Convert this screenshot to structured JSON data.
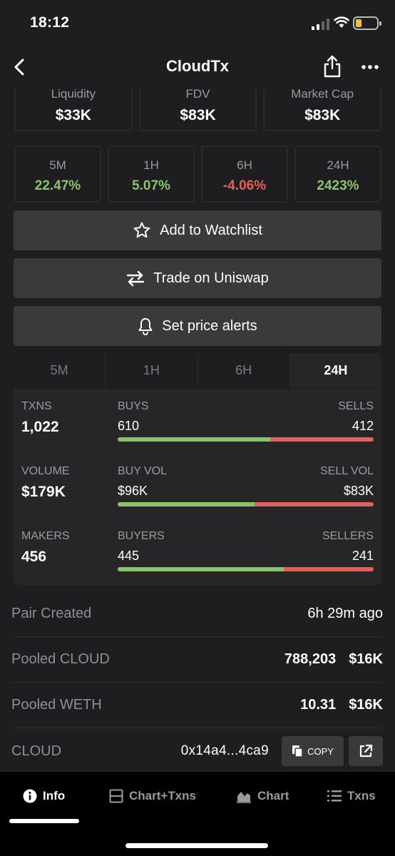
{
  "status": {
    "time": "18:12"
  },
  "nav": {
    "title": "CloudTx"
  },
  "top_stats": [
    {
      "label": "Liquidity",
      "value": "$33K"
    },
    {
      "label": "FDV",
      "value": "$83K"
    },
    {
      "label": "Market Cap",
      "value": "$83K"
    }
  ],
  "price_changes": [
    {
      "label": "5M",
      "value": "22.47%",
      "trend": "up"
    },
    {
      "label": "1H",
      "value": "5.07%",
      "trend": "up"
    },
    {
      "label": "6H",
      "value": "-4.06%",
      "trend": "down"
    },
    {
      "label": "24H",
      "value": "2423%",
      "trend": "up"
    }
  ],
  "actions": {
    "watchlist": "Add to Watchlist",
    "trade": "Trade on Uniswap",
    "alerts": "Set price alerts"
  },
  "period_tabs": [
    {
      "label": "5M",
      "active": false
    },
    {
      "label": "1H",
      "active": false
    },
    {
      "label": "6H",
      "active": false
    },
    {
      "label": "24H",
      "active": true
    }
  ],
  "metrics": {
    "txns": {
      "label": "TXNS",
      "value": "1,022",
      "left_label": "BUYS",
      "left_value": "610",
      "right_label": "SELLS",
      "right_value": "412",
      "left_share": 0.597
    },
    "volume": {
      "label": "VOLUME",
      "value": "$179K",
      "left_label": "BUY VOL",
      "left_value": "$96K",
      "right_label": "SELL VOL",
      "right_value": "$83K",
      "left_share": 0.536
    },
    "makers": {
      "label": "MAKERS",
      "value": "456",
      "left_label": "BUYERS",
      "left_value": "445",
      "right_label": "SELLERS",
      "right_value": "241",
      "left_share": 0.649
    }
  },
  "info": {
    "pair_created": {
      "label": "Pair Created",
      "value": "6h 29m ago"
    },
    "pooled_cloud": {
      "label": "Pooled CLOUD",
      "amount": "788,203",
      "usd": "$16K"
    },
    "pooled_weth": {
      "label": "Pooled WETH",
      "amount": "10.31",
      "usd": "$16K"
    },
    "token": {
      "label": "CLOUD",
      "address": "0x14a4...4ca9",
      "copy_label": "COPY"
    }
  },
  "tabbar": [
    {
      "label": "Info",
      "icon": "info-icon",
      "active": true
    },
    {
      "label": "Chart+Txns",
      "icon": "split-view-icon",
      "active": false
    },
    {
      "label": "Chart",
      "icon": "area-chart-icon",
      "active": false
    },
    {
      "label": "Txns",
      "icon": "list-icon",
      "active": false
    }
  ],
  "colors": {
    "positive": "#8ac46a",
    "negative": "#e4605a",
    "background": "#1e1e21",
    "button": "#3a3a3d"
  }
}
